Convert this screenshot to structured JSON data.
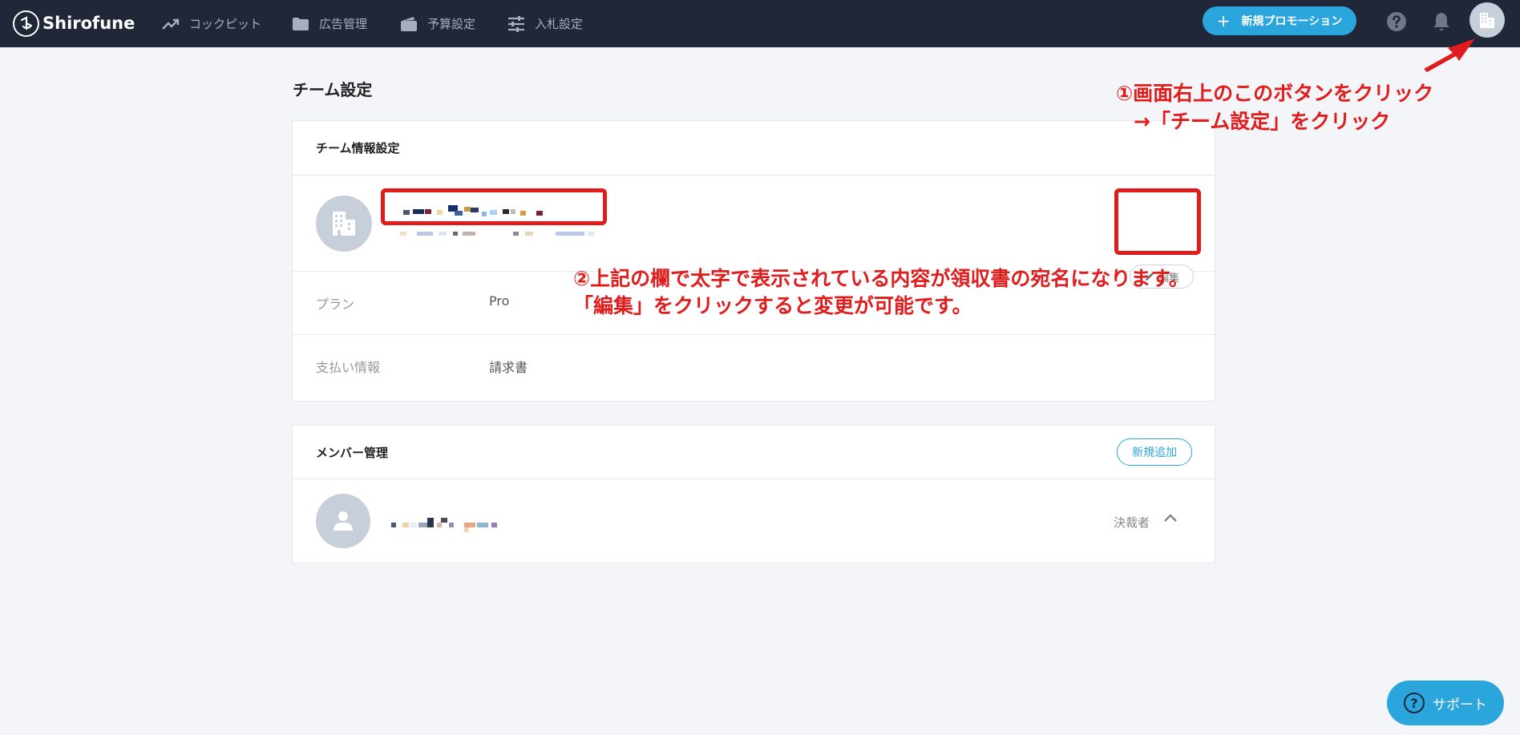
{
  "app": {
    "logo_text": "Shirofune"
  },
  "nav": {
    "items": [
      {
        "label": "コックピット",
        "icon": "trend-icon"
      },
      {
        "label": "広告管理",
        "icon": "folder-icon"
      },
      {
        "label": "予算設定",
        "icon": "wallet-icon"
      },
      {
        "label": "入札設定",
        "icon": "sliders-icon"
      }
    ],
    "new_promotion_label": "新規プロモーション",
    "icons": [
      "help-icon",
      "bell-icon",
      "building-avatar-icon"
    ]
  },
  "page": {
    "title": "チーム設定"
  },
  "team_card": {
    "header": "チーム情報設定",
    "edit_label": "編集",
    "plan_label": "プラン",
    "plan_value": "Pro",
    "payment_label": "支払い情報",
    "payment_value": "請求書"
  },
  "members_card": {
    "header": "メンバー管理",
    "add_label": "新規追加",
    "member_role": "決裁者"
  },
  "annotations": {
    "step1_line1": "①画面右上のこのボタンをクリック",
    "step1_line2": "→「チーム設定」をクリック",
    "step2_line1": "②上記の欄で太字で表示されている内容が領収書の宛名になります。",
    "step2_line2": "「編集」をクリックすると変更が可能です。"
  },
  "support": {
    "label": "サポート"
  },
  "colors": {
    "topbar": "#1f2738",
    "accent": "#2ba6dc",
    "annotation": "#e01c1c"
  }
}
